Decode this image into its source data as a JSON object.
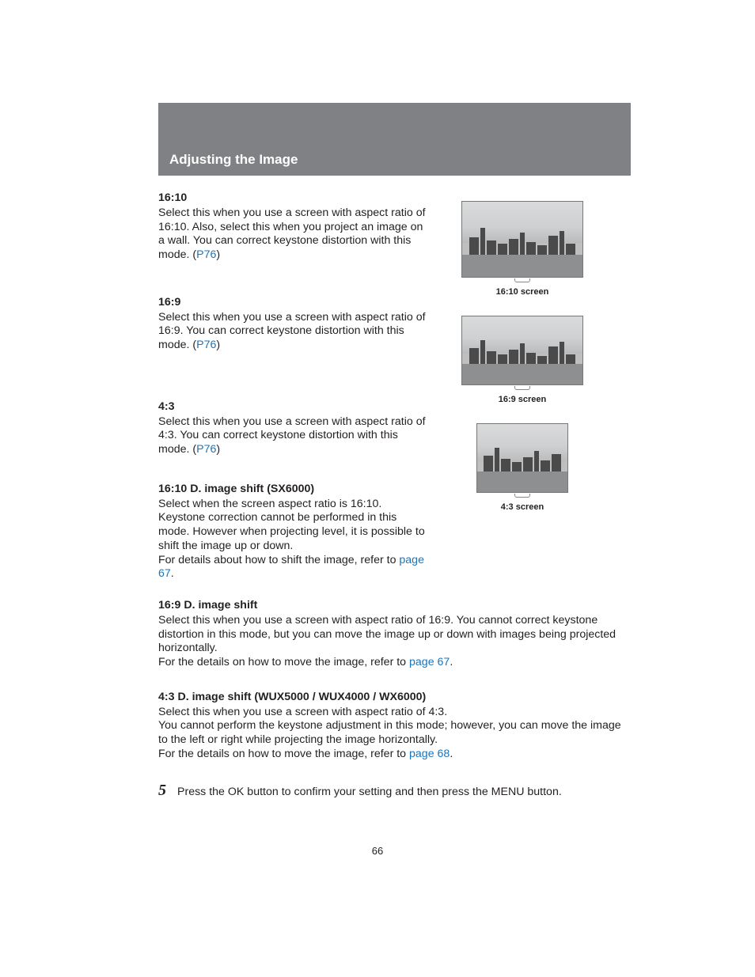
{
  "header": "Adjusting the Image",
  "s16_10": {
    "title": "16:10",
    "t1": "Select this when you use a screen with aspect ratio of 16:10. Also, select this when you project an image on a wall. You can correct keystone distortion with this mode. (",
    "link": "P76",
    "t2": ")"
  },
  "s16_9": {
    "title": "16:9",
    "t1": "Select this when you use a screen with aspect ratio of 16:9. You can correct keystone distortion with this mode. (",
    "link": "P76",
    "t2": ")"
  },
  "s4_3": {
    "title": "4:3",
    "t1": "Select this when you use a screen with aspect ratio of 4:3. You can correct keystone distortion with this mode. (",
    "link": "P76",
    "t2": ")"
  },
  "s16_10d": {
    "title": "16:10 D. image shift (SX6000)",
    "t1a": "Select when the screen aspect ratio is 16:10. Keystone correction cannot be performed in this mode. However when projecting level, it is possible to shift the image up or down.",
    "t1b": "For details about how to shift the image, refer to ",
    "link": "page 67",
    "t2": "."
  },
  "s16_9d": {
    "title": "16:9 D. image shift",
    "t1a": "Select this when you use a screen with aspect ratio of 16:9. You cannot correct keystone distortion in this mode, but you can move the image up or down with images being projected horizontally.",
    "t1b": "For the details on how to move the image, refer to ",
    "link": "page 67",
    "t2": "."
  },
  "s4_3d": {
    "title": "4:3 D. image shift (WUX5000 / WUX4000 / WX6000)",
    "l1": "Select this when you use a screen with aspect ratio of 4:3.",
    "l2": "You cannot perform the keystone adjustment in this mode; however, you can move the image to the left or right while projecting the image horizontally.",
    "l3a": "For the details on how to move the image, refer to ",
    "link": "page 68",
    "l3b": "."
  },
  "step": {
    "num": "5",
    "text": "Press the OK button to confirm your setting and then press the MENU button."
  },
  "captions": {
    "c1": "16:10 screen",
    "c2": "16:9 screen",
    "c3": "4:3 screen"
  },
  "pageNumber": "66"
}
